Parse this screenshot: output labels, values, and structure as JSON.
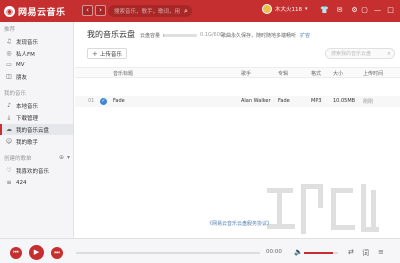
{
  "app": {
    "logo_text": "网易云音乐"
  },
  "header": {
    "search_placeholder": "搜索音乐，歌手，歌词，用户",
    "username": "木大火118"
  },
  "sidebar": {
    "recommend_title": "推荐",
    "recommend_items": [
      {
        "label": "发现音乐",
        "icon": "music-note-icon"
      },
      {
        "label": "私人FM",
        "icon": "radio-icon"
      },
      {
        "label": "MV",
        "icon": "video-icon"
      },
      {
        "label": "朋友",
        "icon": "friends-icon"
      }
    ],
    "my_music_title": "我的音乐",
    "my_music_items": [
      {
        "label": "本地音乐",
        "icon": "local-music-icon"
      },
      {
        "label": "下载管理",
        "icon": "download-icon"
      },
      {
        "label": "我的音乐云盘",
        "icon": "cloud-icon",
        "active": true
      },
      {
        "label": "我的歌手",
        "icon": "singer-icon"
      }
    ],
    "playlist_title": "创建的歌单",
    "playlists": [
      {
        "label": "我喜欢的音乐",
        "icon": "heart-icon"
      },
      {
        "label": "424",
        "icon": "playlist-icon"
      }
    ]
  },
  "main": {
    "title": "我的音乐云盘",
    "capacity_label": "云盘容量",
    "capacity_value": "0.1G/60G",
    "capacity_fraction": 0.02,
    "notice": "歌曲永久保存，随时随地多端畅听",
    "notice_link": "扩容",
    "upload_label": "上传音乐",
    "search_placeholder": "搜索我的音乐云盘",
    "columns": [
      "音乐标题",
      "歌手",
      "专辑",
      "格式",
      "大小",
      "上传时间"
    ],
    "rows": [
      {
        "index": "01",
        "title": "Fade",
        "artist": "Alan Walker",
        "album": "Fade",
        "format": "MP3",
        "size": "10.05MB",
        "uploaded": "刚刚"
      }
    ],
    "footer_link": "《网易云音乐云盘服务协议》"
  },
  "player": {
    "time": "00:00",
    "progress": 0,
    "volume": 0.85
  },
  "colors": {
    "accent": "#c62f2f",
    "link": "#507daf"
  }
}
